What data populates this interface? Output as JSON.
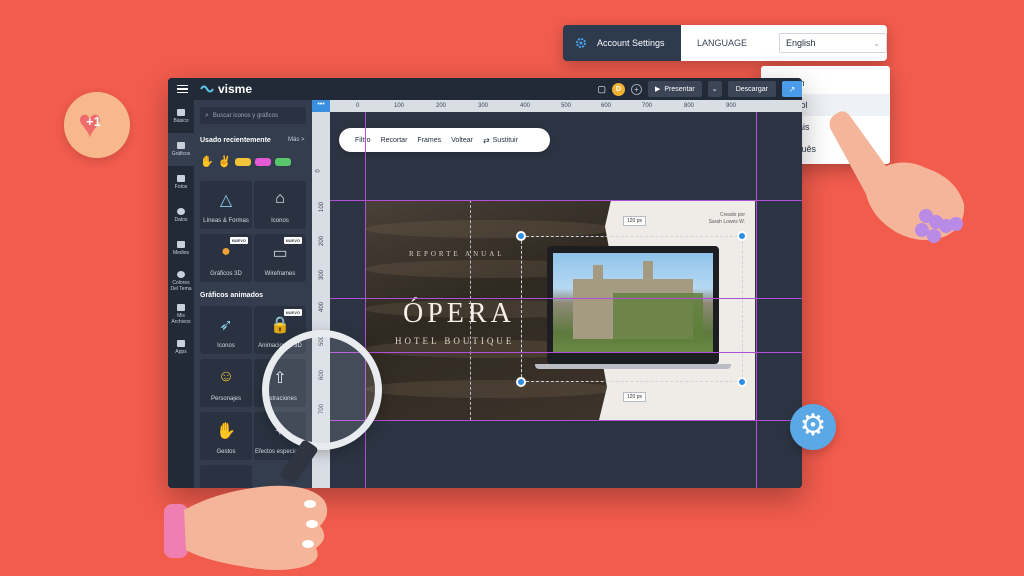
{
  "account_settings": {
    "title": "Account Settings",
    "language_label": "LANGUAGE",
    "language_value": "English",
    "options": [
      "English",
      "Español",
      "Français",
      "Português"
    ],
    "hovered_option": "Español"
  },
  "app": {
    "logo": "visme",
    "topbar": {
      "avatar_initial": "D",
      "present_label": "Presentar",
      "download_label": "Descargar"
    },
    "rail": [
      {
        "label": "Básico",
        "icon": "text-icon"
      },
      {
        "label": "Gráficos",
        "icon": "shapes-icon",
        "active": true
      },
      {
        "label": "Fotos",
        "icon": "photo-icon"
      },
      {
        "label": "Datos",
        "icon": "chart-icon"
      },
      {
        "label": "Medios",
        "icon": "video-icon"
      },
      {
        "label": "Colores Del Tema",
        "icon": "palette-icon"
      },
      {
        "label": "Mis Archivos",
        "icon": "folder-icon"
      },
      {
        "label": "Apps",
        "icon": "apps-icon"
      }
    ],
    "panel": {
      "search_placeholder": "Buscar iconos y gráficos",
      "recent_title": "Usado recientemente",
      "more_label": "Más >",
      "tiles": [
        {
          "label": "Líneas & Formas"
        },
        {
          "label": "Iconos"
        },
        {
          "label": "Gráficos 3D",
          "badge": "NUEVO"
        },
        {
          "label": "Wireframes",
          "badge": "NUEVO"
        }
      ],
      "animated_title": "Gráficos animados",
      "animated_tiles": [
        {
          "label": "Iconos"
        },
        {
          "label": "Animaciones 3D",
          "badge": "NUEVO"
        },
        {
          "label": "Personajes"
        },
        {
          "label": "Ilustraciones"
        },
        {
          "label": "Gestos"
        },
        {
          "label": "Efectos especiales"
        }
      ]
    },
    "ruler": {
      "top": [
        "0",
        "100",
        "200",
        "300",
        "400",
        "500",
        "600",
        "700",
        "800",
        "900"
      ],
      "left": [
        "0",
        "100",
        "200",
        "300",
        "400",
        "500",
        "600",
        "700"
      ]
    },
    "image_toolbar": [
      "Filtro",
      "Recortar",
      "Frames",
      "Voltear",
      "Sustituir"
    ],
    "slide": {
      "reporte": "REPORTE ANUAL",
      "title": "ÓPERA",
      "subtitle": "HOTEL BOUTIQUE",
      "credit_line1": "Creado por",
      "credit_line2": "Sarah Lowes W.",
      "dim_top": "120 px",
      "dim_bottom": "120 px"
    }
  },
  "badge_plus_one": "+1"
}
